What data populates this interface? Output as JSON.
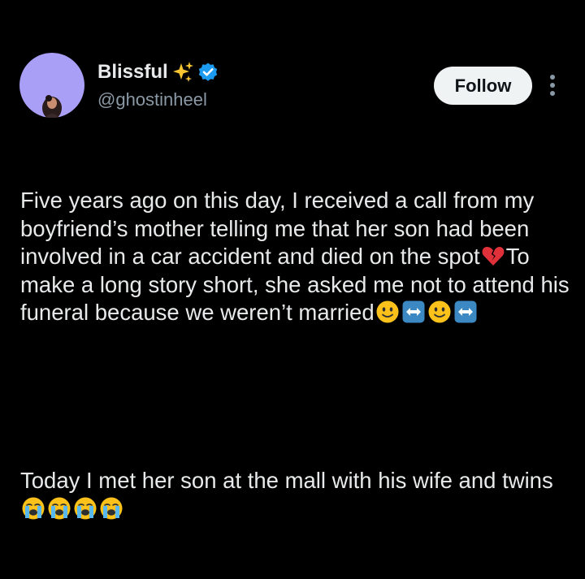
{
  "author": {
    "display_name": "Blissful",
    "name_emoji_icon": "sparkles-icon",
    "verified_icon": "verified-badge-icon",
    "handle": "@ghostinheel",
    "avatar_bg": "#a99ff7"
  },
  "actions": {
    "follow_label": "Follow",
    "more_icon": "more-vertical-icon"
  },
  "post": {
    "p1_part1": "Five years ago on this day, I received a call from my boyfriend’s mother telling me that her son had been involved in a car accident and died on the spot",
    "p1_part2": "To make a long story short, she asked me not to attend his funeral because we weren’t married",
    "p2_part1": "Today I met her son at the mall with his wife and twins",
    "emojis": [
      "broken-heart-icon",
      "slightly-smiling-face-icon",
      "left-right-arrow-icon",
      "slightly-smiling-face-icon",
      "left-right-arrow-icon",
      "loudly-crying-face-icon",
      "loudly-crying-face-icon",
      "loudly-crying-face-icon",
      "loudly-crying-face-icon"
    ]
  },
  "colors": {
    "background": "#000000",
    "text": "#e7e9ea",
    "secondary_text": "#8b98a5",
    "verified": "#1d9bf0",
    "follow_bg": "#eff3f4"
  }
}
